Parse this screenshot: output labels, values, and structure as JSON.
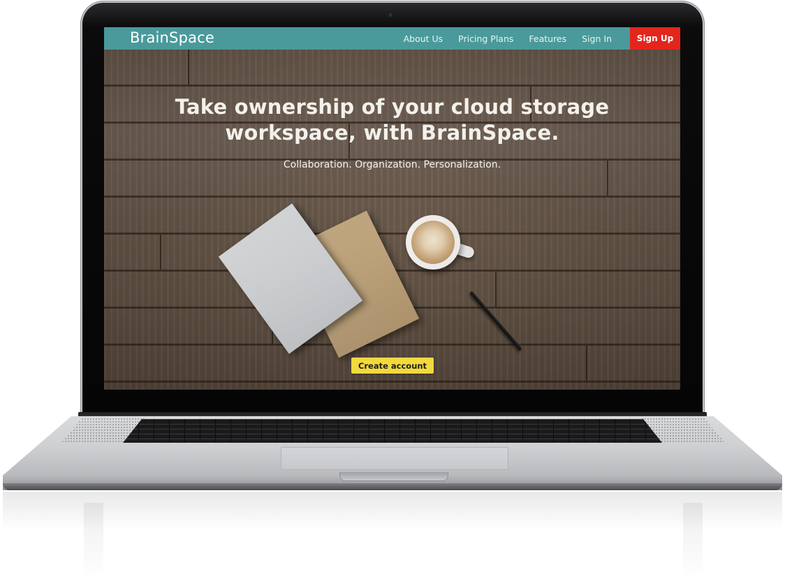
{
  "site": {
    "brand": "BrainSpace",
    "nav": {
      "links": [
        "About Us",
        "Pricing Plans",
        "Features",
        "Sign In"
      ],
      "signup_label": "Sign Up"
    },
    "hero": {
      "headline_line1": "Take ownership of your cloud storage",
      "headline_line2": "workspace, with BrainSpace.",
      "tagline": "Collaboration. Organization. Personalization.",
      "cta_label": "Create account"
    }
  },
  "colors": {
    "nav_background": "#4a9a9b",
    "signup_button": "#e3261c",
    "cta_button": "#f2d93e",
    "headline_text": "#f4f1ec"
  },
  "icons": {
    "camera": "laptop-camera-icon"
  }
}
